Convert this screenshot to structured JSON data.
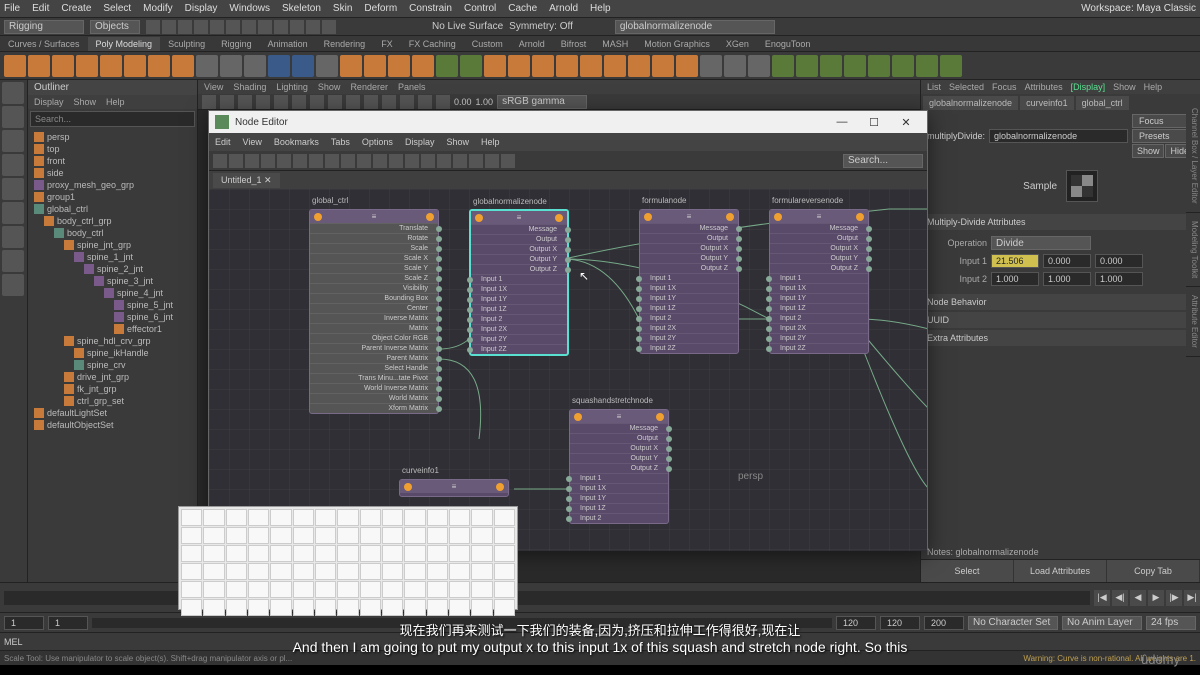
{
  "workspace": "Maya Classic",
  "menubar": [
    "File",
    "Edit",
    "Create",
    "Select",
    "Modify",
    "Display",
    "Windows",
    "Skeleton",
    "Skin",
    "Deform",
    "Constrain",
    "Control",
    "Cache",
    "Arnold",
    "Help"
  ],
  "mode_dropdown": "Rigging",
  "objects_label": "Objects",
  "symmetry": "Symmetry: Off",
  "nolive": "No Live Surface",
  "search_field": "globalnormalizenode",
  "shelf_tabs": [
    "Curves / Surfaces",
    "Poly Modeling",
    "Sculpting",
    "Rigging",
    "Animation",
    "Rendering",
    "FX",
    "FX Caching",
    "Custom",
    "Arnold",
    "Bifrost",
    "MASH",
    "Motion Graphics",
    "XGen",
    "EnoguToon"
  ],
  "shelf_active": "Poly Modeling",
  "outliner": {
    "title": "Outliner",
    "menu": [
      "Display",
      "Show",
      "Help"
    ],
    "search": "Search...",
    "items": [
      {
        "label": "persp",
        "i": 0
      },
      {
        "label": "top",
        "i": 0
      },
      {
        "label": "front",
        "i": 0
      },
      {
        "label": "side",
        "i": 0
      },
      {
        "label": "proxy_mesh_geo_grp",
        "i": 0,
        "icon": "jnt"
      },
      {
        "label": "group1",
        "i": 0
      },
      {
        "label": "global_ctrl",
        "i": 0,
        "icon": "crv"
      },
      {
        "label": "body_ctrl_grp",
        "i": 1
      },
      {
        "label": "body_ctrl",
        "i": 2,
        "icon": "crv"
      },
      {
        "label": "spine_jnt_grp",
        "i": 3
      },
      {
        "label": "spine_1_jnt",
        "i": 4,
        "icon": "jnt"
      },
      {
        "label": "spine_2_jnt",
        "i": 5,
        "icon": "jnt"
      },
      {
        "label": "spine_3_jnt",
        "i": 6,
        "icon": "jnt"
      },
      {
        "label": "spine_4_jnt",
        "i": 7,
        "icon": "jnt"
      },
      {
        "label": "spine_5_jnt",
        "i": 8,
        "icon": "jnt"
      },
      {
        "label": "spine_6_jnt",
        "i": 8,
        "icon": "jnt"
      },
      {
        "label": "effector1",
        "i": 8
      },
      {
        "label": "spine_hdl_crv_grp",
        "i": 3
      },
      {
        "label": "spine_ikHandle",
        "i": 4
      },
      {
        "label": "spine_crv",
        "i": 4,
        "icon": "crv"
      },
      {
        "label": "drive_jnt_grp",
        "i": 3
      },
      {
        "label": "fk_jnt_grp",
        "i": 3
      },
      {
        "label": "ctrl_grp_set",
        "i": 3
      },
      {
        "label": "defaultLightSet",
        "i": 0
      },
      {
        "label": "defaultObjectSet",
        "i": 0
      }
    ]
  },
  "viewport": {
    "menu": [
      "View",
      "Shading",
      "Lighting",
      "Show",
      "Renderer",
      "Panels"
    ],
    "gamma": "sRGB gamma",
    "vals": [
      "0.00",
      "1.00"
    ],
    "persp": "persp"
  },
  "node_editor": {
    "title": "Node Editor",
    "menu": [
      "Edit",
      "View",
      "Bookmarks",
      "Tabs",
      "Options",
      "Display",
      "Show",
      "Help"
    ],
    "tab": "Untitled_1",
    "search": "Search...",
    "nodes": {
      "global_ctrl": {
        "label": "global_ctrl",
        "rows": [
          "Translate",
          "Rotate",
          "Scale",
          "Scale X",
          "Scale Y",
          "Scale Z",
          "Visibility",
          "Bounding Box",
          "Center",
          "Inverse Matrix",
          "Matrix",
          "Object Color RGB",
          "Parent Inverse Matrix",
          "Parent Matrix",
          "Select Handle",
          "Trans Minu...tate Pivot",
          "World Inverse Matrix",
          "World Matrix",
          "Xform Matrix"
        ]
      },
      "globalnormalize": {
        "label": "globalnormalizenode",
        "outs": [
          "Message",
          "Output",
          "Output X",
          "Output Y",
          "Output Z"
        ],
        "ins": [
          "Input 1",
          "Input 1X",
          "Input 1Y",
          "Input 1Z",
          "Input 2",
          "Input 2X",
          "Input 2Y",
          "Input 2Z"
        ]
      },
      "formula": {
        "label": "formulanode",
        "outs": [
          "Message",
          "Output",
          "Output X",
          "Output Y",
          "Output Z"
        ],
        "ins": [
          "Input 1",
          "Input 1X",
          "Input 1Y",
          "Input 1Z",
          "Input 2",
          "Input 2X",
          "Input 2Y",
          "Input 2Z"
        ]
      },
      "formulareverse": {
        "label": "formulareversenode",
        "outs": [
          "Message",
          "Output",
          "Output X",
          "Output Y",
          "Output Z"
        ],
        "ins": [
          "Input 1",
          "Input 1X",
          "Input 1Y",
          "Input 1Z",
          "Input 2",
          "Input 2X",
          "Input 2Y",
          "Input 2Z"
        ]
      },
      "squash": {
        "label": "squashandstretchnode",
        "outs": [
          "Message",
          "Output",
          "Output X",
          "Output Y",
          "Output Z"
        ],
        "ins": [
          "Input 1",
          "Input 1X",
          "Input 1Y",
          "Input 1Z",
          "Input 2"
        ]
      },
      "curveinfo": {
        "label": "curveinfo1"
      }
    }
  },
  "attr_editor": {
    "menu": [
      "List",
      "Selected",
      "Focus",
      "Attributes",
      "Show",
      "Help"
    ],
    "display": "[Display]",
    "tabs": [
      "globalnormalizenode",
      "curveinfo1",
      "global_ctrl"
    ],
    "type_label": "multiplyDivide:",
    "node_name": "globalnormalizenode",
    "focus_btn": "Focus",
    "presets_btn": "Presets",
    "show_btn": "Show",
    "hide_btn": "Hide",
    "sample_label": "Sample",
    "section1": "Multiply-Divide Attributes",
    "op_label": "Operation",
    "op_value": "Divide",
    "input1_label": "Input 1",
    "input1": [
      "21.506",
      "0.000",
      "0.000"
    ],
    "input2_label": "Input 2",
    "input2": [
      "1.000",
      "1.000",
      "1.000"
    ],
    "section2": "Node Behavior",
    "section3": "UUID",
    "section4": "Extra Attributes",
    "notes_label": "Notes: globalnormalizenode",
    "btn_select": "Select",
    "btn_load": "Load Attributes",
    "btn_copy": "Copy Tab"
  },
  "timeline": {
    "start": "1",
    "end": "120",
    "range_start": "1",
    "range_end": "120",
    "total": "200",
    "charset": "No Character Set",
    "animlayer": "No Anim Layer",
    "fps": "24 fps"
  },
  "cmdline_label": "MEL",
  "helpline": "Scale Tool: Use manipulator to scale object(s). Shift+drag manipulator axis or pl...",
  "helpline_warn": "Warning: Curve is non-rational. All weights are 1.",
  "subtitle_cn": "现在我们再来测试一下我们的装备,因为,挤压和拉伸工作得很好,现在让",
  "subtitle_en": "And then I am going to put my output x to this input 1x of this squash and stretch node right. So this",
  "udemy": "ûdemy",
  "edge_tabs": [
    "Channel Box / Layer Editor",
    "Modeling Toolkit",
    "Attribute Editor"
  ]
}
